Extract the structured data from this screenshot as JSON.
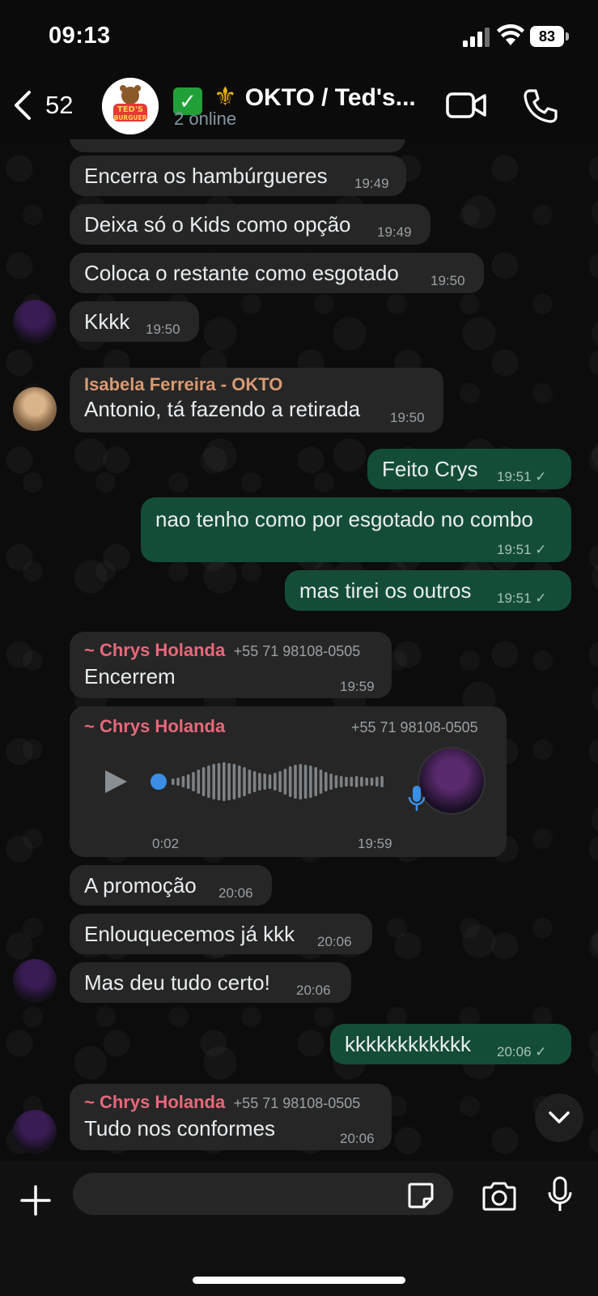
{
  "status_bar": {
    "time": "09:13",
    "battery": "83"
  },
  "header": {
    "back_count": "52",
    "group_name": "OKTO / Ted's...",
    "group_logo_text": "TED'S BURGUER",
    "subtitle": "2 online"
  },
  "messages": [
    {
      "id": "m1",
      "dir": "in",
      "text": "Encerra os hambúrgueres",
      "time": "19:49"
    },
    {
      "id": "m2",
      "dir": "in",
      "text": "Deixa só o Kids como opção",
      "time": "19:49"
    },
    {
      "id": "m3",
      "dir": "in",
      "text": "Coloca o restante como esgotado",
      "time": "19:50"
    },
    {
      "id": "m4",
      "dir": "in",
      "text": "Kkkk",
      "time": "19:50"
    },
    {
      "id": "m5",
      "dir": "in",
      "sender": "Isabela Ferreira - OKTO",
      "text": "Antonio, tá fazendo a retirada",
      "time": "19:50"
    },
    {
      "id": "m6",
      "dir": "out",
      "text": "Feito Crys",
      "time": "19:51"
    },
    {
      "id": "m7",
      "dir": "out",
      "text": "nao tenho como por esgotado no combo",
      "time": "19:51"
    },
    {
      "id": "m8",
      "dir": "out",
      "text": "mas tirei os outros",
      "time": "19:51"
    },
    {
      "id": "m9",
      "dir": "in",
      "sender": "~ Chrys Holanda",
      "phone": "+55 71 98108-0505",
      "text": "Encerrem",
      "time": "19:59"
    },
    {
      "id": "m10",
      "dir": "in",
      "type": "voice",
      "sender": "~ Chrys Holanda",
      "phone": "+55 71 98108-0505",
      "duration": "0:02",
      "time": "19:59",
      "progress": 0
    },
    {
      "id": "m11",
      "dir": "in",
      "text": "A promoção",
      "time": "20:06"
    },
    {
      "id": "m12",
      "dir": "in",
      "text": "Enlouquecemos já kkk",
      "time": "20:06"
    },
    {
      "id": "m13",
      "dir": "in",
      "text": "Mas deu tudo certo!",
      "time": "20:06"
    },
    {
      "id": "m14",
      "dir": "out",
      "text": "kkkkkkkkkkkk",
      "time": "20:06"
    },
    {
      "id": "m15",
      "dir": "in",
      "sender": "~ Chrys Holanda",
      "phone": "+55 71 98108-0505",
      "text": "Tudo nos conformes",
      "time": "20:06"
    }
  ],
  "input": {
    "placeholder": ""
  },
  "colors": {
    "incoming_bubble": "#262626",
    "outgoing_bubble": "#144d37",
    "sender_pink": "#e8687a",
    "sender_orange": "#d99a71",
    "accent_blue": "#3a8ee6"
  },
  "icons": [
    "chevron-left-icon",
    "video-camera-icon",
    "phone-icon",
    "plus-icon",
    "sticker-icon",
    "camera-icon",
    "microphone-icon",
    "play-icon",
    "chevron-down-icon",
    "check-icon"
  ]
}
